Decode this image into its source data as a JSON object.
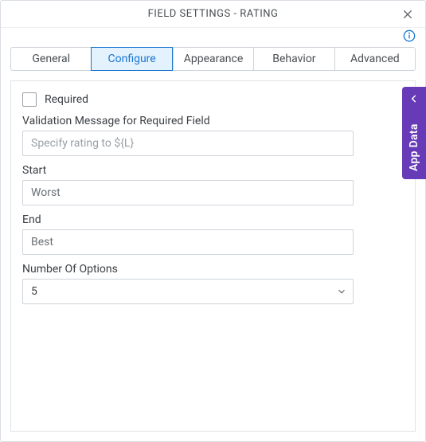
{
  "title": "FIELD SETTINGS - RATING",
  "tabs": {
    "general": "General",
    "configure": "Configure",
    "appearance": "Appearance",
    "behavior": "Behavior",
    "advanced": "Advanced"
  },
  "form": {
    "required_label": "Required",
    "validation_label": "Validation Message for Required Field",
    "validation_placeholder": "Specify rating to ${L}",
    "validation_value": "",
    "start_label": "Start",
    "start_value": "Worst",
    "end_label": "End",
    "end_value": "Best",
    "num_options_label": "Number Of Options",
    "num_options_value": "5"
  },
  "side_tab": "App Data"
}
